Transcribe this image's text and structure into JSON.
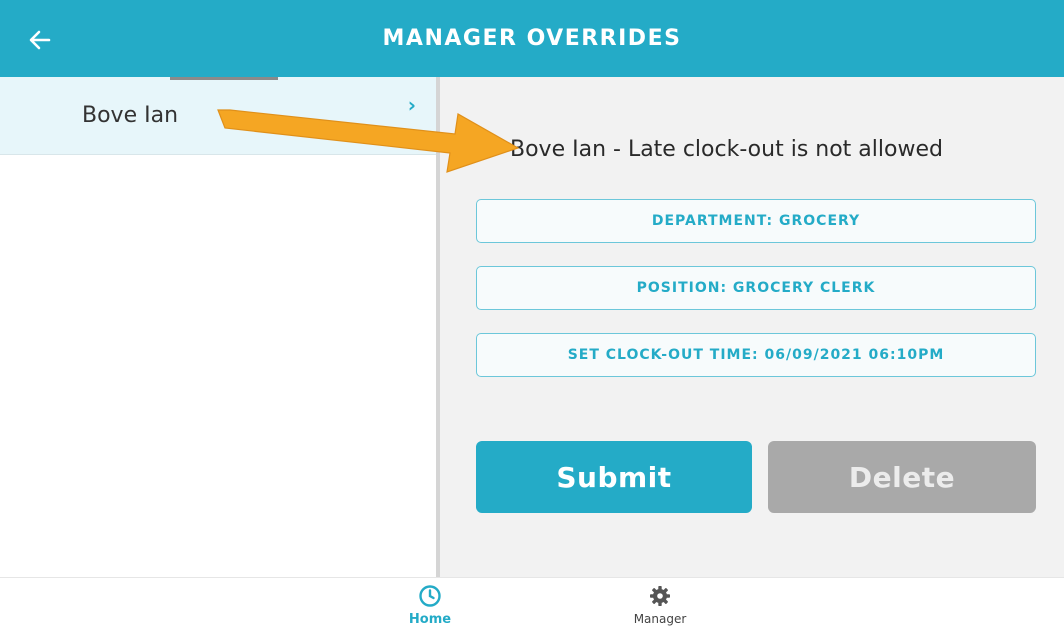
{
  "header": {
    "title": "MANAGER OVERRIDES",
    "back_icon": "back-arrow-icon",
    "color": "#24abc7"
  },
  "sidebar": {
    "items": [
      {
        "label": "Bove Ian",
        "selected": true,
        "icon": "chevron-right-icon"
      }
    ],
    "chevron": "›"
  },
  "main": {
    "message": "Bove Ian - Late clock-out is not allowed",
    "fields": [
      {
        "label": "DEPARTMENT: GROCERY"
      },
      {
        "label": "POSITION: GROCERY CLERK"
      },
      {
        "label": "SET CLOCK-OUT TIME: 06/09/2021 06:10PM"
      }
    ],
    "submit_label": "Submit",
    "delete_label": "Delete"
  },
  "bottom_nav": {
    "items": [
      {
        "label": "Home",
        "icon": "clock-icon",
        "active": true
      },
      {
        "label": "Manager",
        "icon": "gear-icon",
        "active": false
      }
    ]
  },
  "colors": {
    "accent": "#24abc7",
    "annotation_arrow": "#f5a623",
    "disabled": "#a9a9a9"
  }
}
